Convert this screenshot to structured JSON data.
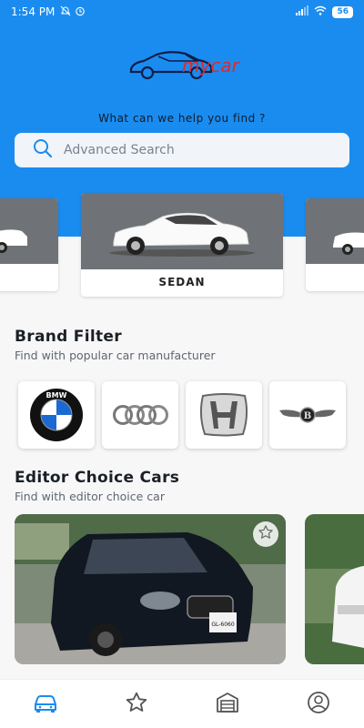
{
  "status_bar": {
    "time": "1:54 PM",
    "battery": "56"
  },
  "header": {
    "logo_text": "mycar",
    "tagline": "What can we help you find ?",
    "search_placeholder": "Advanced Search"
  },
  "car_types": [
    {
      "label": ""
    },
    {
      "label": "SEDAN"
    },
    {
      "label": ""
    }
  ],
  "brand_filter": {
    "title": "Brand Filter",
    "subtitle": "Find with popular car manufacturer",
    "brands": [
      {
        "name": "BMW",
        "logo_text": "BMW"
      },
      {
        "name": "Audi",
        "logo_text": ""
      },
      {
        "name": "Honda",
        "logo_text": ""
      },
      {
        "name": "Bentley",
        "logo_text": "B"
      }
    ]
  },
  "editor_choice": {
    "title": "Editor Choice Cars",
    "subtitle": "Find with editor choice car",
    "plate_text": "GL-6060"
  },
  "nav": [
    {
      "icon": "car-icon",
      "active": true
    },
    {
      "icon": "star-icon",
      "active": false
    },
    {
      "icon": "garage-icon",
      "active": false
    },
    {
      "icon": "profile-icon",
      "active": false
    }
  ],
  "colors": {
    "primary": "#1a8cf0",
    "logo_red": "#e02a2a",
    "logo_navy": "#0d1e4a"
  }
}
